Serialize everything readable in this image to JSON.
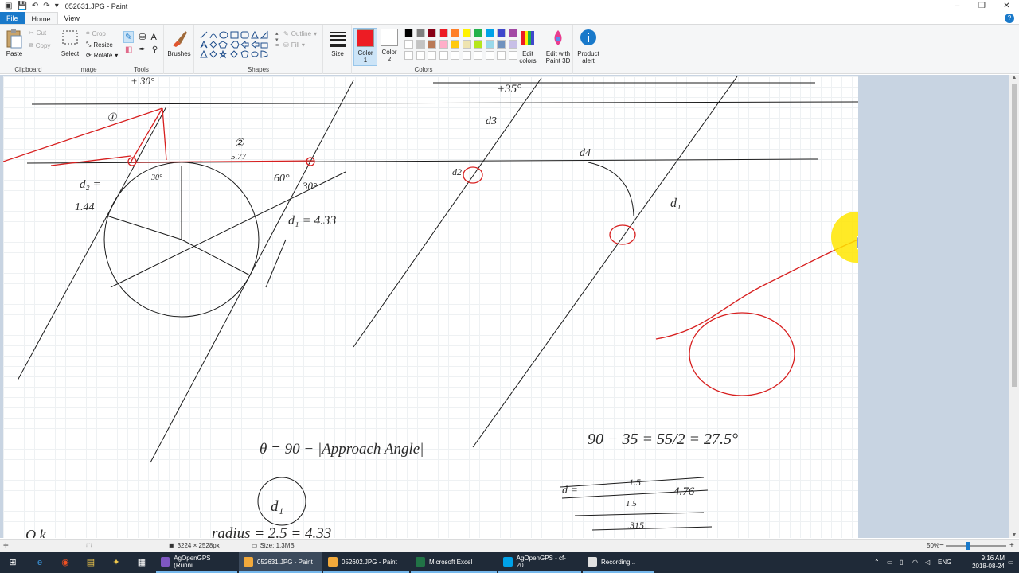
{
  "window": {
    "title": "052631.JPG - Paint",
    "minimize_glyph": "–",
    "restore_glyph": "❐",
    "close_glyph": "✕"
  },
  "quick_access": {
    "save_icon": "save-icon",
    "undo_icon": "undo-icon",
    "redo_icon": "redo-icon"
  },
  "tabs": [
    {
      "label": "File"
    },
    {
      "label": "Home"
    },
    {
      "label": "View"
    }
  ],
  "ribbon": {
    "clipboard": {
      "title": "Clipboard",
      "paste": "Paste",
      "cut": "Cut",
      "copy": "Copy"
    },
    "image": {
      "title": "Image",
      "select": "Select",
      "crop": "Crop",
      "resize": "Resize",
      "rotate": "Rotate"
    },
    "tools": {
      "title": "Tools",
      "text_glyph": "A"
    },
    "brushes": {
      "label": "Brushes"
    },
    "shapes": {
      "title": "Shapes",
      "outline": "Outline",
      "fill": "Fill"
    },
    "size": {
      "label": "Size"
    },
    "color1": {
      "label_line1": "Color",
      "label_line2": "1",
      "value": "#ed1c24"
    },
    "color2": {
      "label_line1": "Color",
      "label_line2": "2",
      "value": "#ffffff"
    },
    "colors": {
      "title": "Colors"
    },
    "edit_colors": {
      "line1": "Edit",
      "line2": "colors"
    },
    "paint3d": {
      "line1": "Edit with",
      "line2": "Paint 3D"
    },
    "product_alert": {
      "line1": "Product",
      "line2": "alert"
    }
  },
  "palette_row1": [
    "#000000",
    "#7f7f7f",
    "#880015",
    "#ed1c24",
    "#ff7f27",
    "#fff200",
    "#22b14c",
    "#00a2e8",
    "#3f48cc",
    "#a349a4"
  ],
  "palette_row2": [
    "#ffffff",
    "#c3c3c3",
    "#b97a57",
    "#ffaec9",
    "#ffc90e",
    "#efe4b0",
    "#b5e61d",
    "#99d9ea",
    "#7092be",
    "#c8bfe7"
  ],
  "drawing": {
    "circle1_label": "①",
    "circle2_label": "②",
    "dim_577": "5.77",
    "label_d2": "d₂ =",
    "value_144": "1.44",
    "angle_60": "60°",
    "angle_30": "30°",
    "angle_30b": "30°",
    "d1_eq": "d₁ = 4.33",
    "d3": "d3",
    "d4": "d4",
    "d2_right": "d2",
    "d1_right": "d₁",
    "top_left": "+ 30°",
    "top_right": "+35°",
    "theta_eq": "θ = 90 − |Approach Angle|",
    "calc": "90 − 35 = 55/2 = 27.5°",
    "d1_circle": "d₁",
    "radius_eq": "radius = 2.5 = 4.33",
    "bottom_left": "Q k",
    "d_eq": "d =",
    "scratch_top": "1.5",
    "scratch_val": "4.76",
    "scratch_mid": "1.5",
    "scratch_bottom": ".315"
  },
  "statusbar": {
    "dimensions": "3224 × 2528px",
    "size": "Size: 1.3MB",
    "zoom": "50%",
    "zoom_level": 0.5
  },
  "taskbar": {
    "tasks": [
      {
        "label": "AgOpenGPS (Runni...",
        "color": "#7e57c2"
      },
      {
        "label": "052631.JPG - Paint",
        "color": "#f2a93b"
      },
      {
        "label": "052602.JPG - Paint",
        "color": "#f2a93b"
      },
      {
        "label": "Microsoft Excel",
        "color": "#217346"
      },
      {
        "label": "AgOpenGPS - cf-20...",
        "color": "#00a2e8"
      },
      {
        "label": "Recording...",
        "color": "#e0e0e0"
      }
    ],
    "lang": "ENG",
    "time": "9:16 AM",
    "date": "2018-08-24"
  }
}
